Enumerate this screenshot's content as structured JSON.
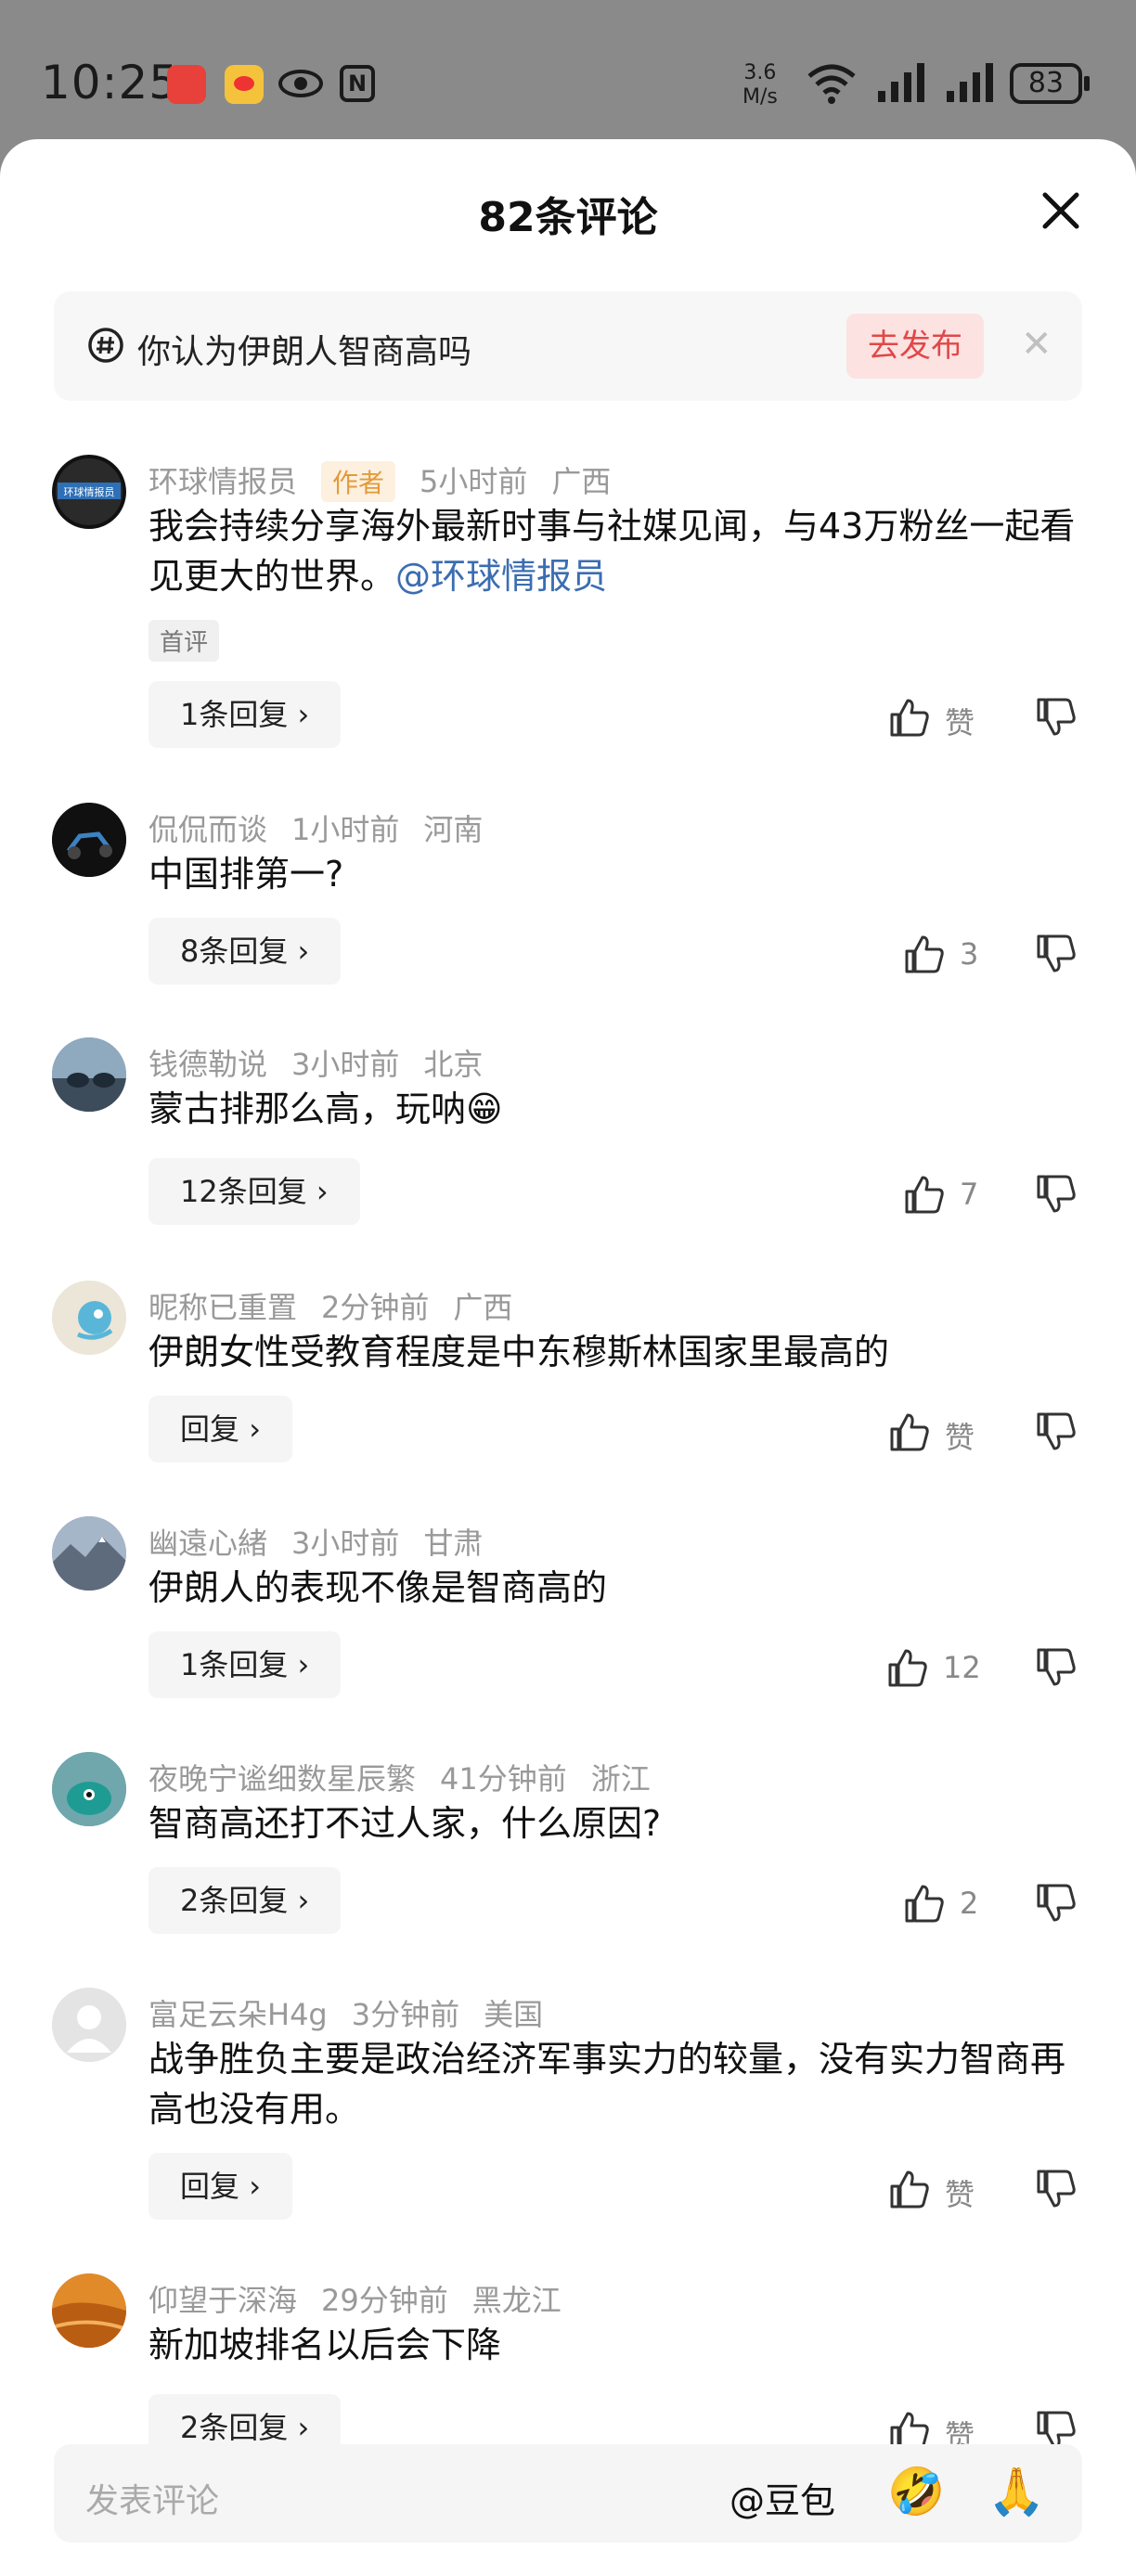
{
  "status_bar": {
    "time": "10:25",
    "network_speed_top": "3.6",
    "network_speed_bottom": "M/s",
    "battery": "83",
    "icons": [
      "huawei-app-icon",
      "weibo-icon",
      "eye-icon",
      "nfc-icon",
      "wifi-icon",
      "signal-icon",
      "signal-icon",
      "battery-icon"
    ]
  },
  "sheet": {
    "title": "82条评论"
  },
  "topic": {
    "text": "你认为伊朗人智商高吗",
    "button": "去发布"
  },
  "comments": [
    {
      "user": "环球情报员",
      "author_badge": "作者",
      "time": "5小时前",
      "location": "广西",
      "text": "我会持续分享海外最新时事与社媒见闻，与43万粉丝一起看见更大的世界。",
      "mention": "@环球情报员",
      "tag": "首评",
      "reply": "1条回复",
      "likes": "赞"
    },
    {
      "user": "侃侃而谈",
      "time": "1小时前",
      "location": "河南",
      "text": "中国排第一?",
      "reply": "8条回复",
      "likes": "3"
    },
    {
      "user": "钱德勒说",
      "time": "3小时前",
      "location": "北京",
      "text": "蒙古排那么高，玩呐😁",
      "reply": "12条回复",
      "likes": "7"
    },
    {
      "user": "昵称已重置",
      "time": "2分钟前",
      "location": "广西",
      "text": "伊朗女性受教育程度是中东穆斯林国家里最高的",
      "reply": "回复",
      "likes": "赞"
    },
    {
      "user": "幽遠心緒",
      "time": "3小时前",
      "location": "甘肃",
      "text": "伊朗人的表现不像是智商高的",
      "reply": "1条回复",
      "likes": "12"
    },
    {
      "user": "夜晚宁谧细数星辰繁",
      "time": "41分钟前",
      "location": "浙江",
      "text": "智商高还打不过人家，什么原因?",
      "reply": "2条回复",
      "likes": "2"
    },
    {
      "user": "富足云朵H4g",
      "time": "3分钟前",
      "location": "美国",
      "text": "战争胜负主要是政治经济军事实力的较量，没有实力智商再高也没有用。",
      "reply": "回复",
      "likes": "赞"
    },
    {
      "user": "仰望于深海",
      "time": "29分钟前",
      "location": "黑龙江",
      "text": "新加坡排名以后会下降",
      "reply": "2条回复",
      "likes": "赞"
    }
  ],
  "bottom_bar": {
    "placeholder": "发表评论",
    "at_label": "@豆包",
    "emoji_1": "🤣",
    "emoji_2": "🙏"
  }
}
